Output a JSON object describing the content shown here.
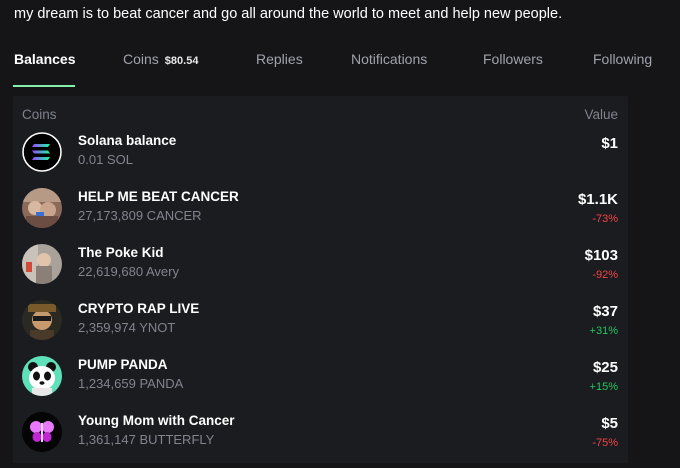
{
  "bio": "my dream is to beat cancer and go all around the world to meet and help new people.",
  "tabs": {
    "balances": "Balances",
    "coins": "Coins",
    "coins_badge": "$80.54",
    "replies": "Replies",
    "notifications": "Notifications",
    "followers": "Followers",
    "following": "Following"
  },
  "table": {
    "col_coins": "Coins",
    "col_value": "Value",
    "rows": [
      {
        "name": "Solana balance",
        "amount": "0.01 SOL",
        "value": "$1",
        "change": "",
        "icon": "solana-icon"
      },
      {
        "name": "HELP ME BEAT CANCER",
        "amount": "27,173,809 CANCER",
        "value": "$1.1K",
        "change": "-73%",
        "icon": "coin-avatar"
      },
      {
        "name": "The Poke Kid",
        "amount": "22,619,680 Avery",
        "value": "$103",
        "change": "-92%",
        "icon": "coin-avatar"
      },
      {
        "name": "CRYPTO RAP LIVE",
        "amount": "2,359,974 YNOT",
        "value": "$37",
        "change": "+31%",
        "icon": "coin-avatar"
      },
      {
        "name": "PUMP PANDA",
        "amount": "1,234,659 PANDA",
        "value": "$25",
        "change": "+15%",
        "icon": "panda-icon"
      },
      {
        "name": "Young Mom with Cancer",
        "amount": "1,361,147 BUTTERFLY",
        "value": "$5",
        "change": "-75%",
        "icon": "butterfly-icon"
      }
    ]
  },
  "colors": {
    "background": "#151518",
    "panel": "#1b1c20",
    "accent": "#86efac",
    "negative": "#ef4444",
    "positive": "#22c55e"
  }
}
